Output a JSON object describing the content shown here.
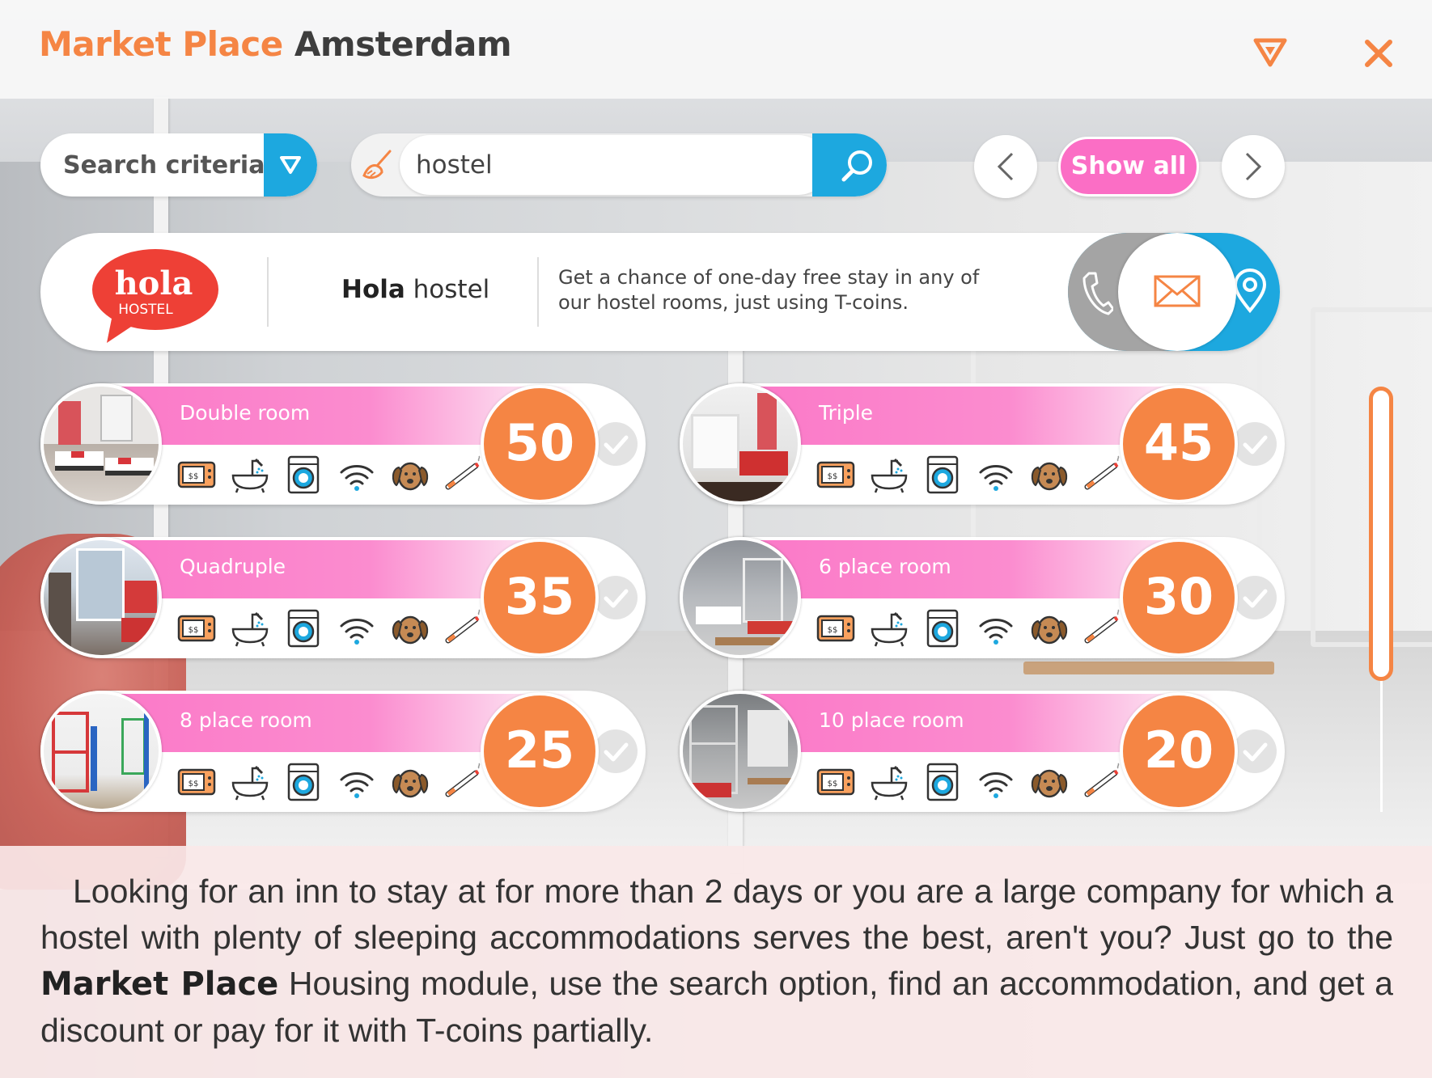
{
  "header": {
    "title_brand": "Market Place",
    "title_city": "Amsterdam",
    "filter_icon": "filter-triangle-icon",
    "close_icon": "close-x-icon"
  },
  "search": {
    "criteria_label": "Search criteria",
    "query": "hostel",
    "show_all_label": "Show all"
  },
  "hostel": {
    "logo_text": "hola",
    "logo_subtext": "HOSTEL",
    "name_bold": "Hola",
    "name_rest": "hostel",
    "promo": "Get a chance of one-day free stay in any of our hostel rooms, just using T-coins.",
    "contacts": [
      "phone-icon",
      "mail-icon",
      "location-pin-icon"
    ]
  },
  "amenities": [
    "microwave-icon",
    "bath-shower-icon",
    "washing-machine-icon",
    "wifi-icon",
    "dog-icon",
    "cigarette-icon"
  ],
  "rooms": [
    {
      "name": "Double room",
      "price": "50"
    },
    {
      "name": "Triple",
      "price": "45"
    },
    {
      "name": "Quadruple",
      "price": "35"
    },
    {
      "name": "6 place room",
      "price": "30"
    },
    {
      "name": "8 place room",
      "price": "25"
    },
    {
      "name": "10 place room",
      "price": "20"
    }
  ],
  "footer": {
    "text_1": "Looking for an inn to stay at for more than 2 days or you are a large company for which a hostel with plenty of sleeping accommodations serves the best, aren't you? Just go to the ",
    "text_bold": "Market Place",
    "text_2": " Housing module, use the search option, find an accommodation, and get a discount or pay for it with T-coins partially."
  },
  "colors": {
    "orange": "#f58544",
    "pink": "#fb6ec5",
    "blue": "#1da8df",
    "grey": "#a4a4a4"
  }
}
